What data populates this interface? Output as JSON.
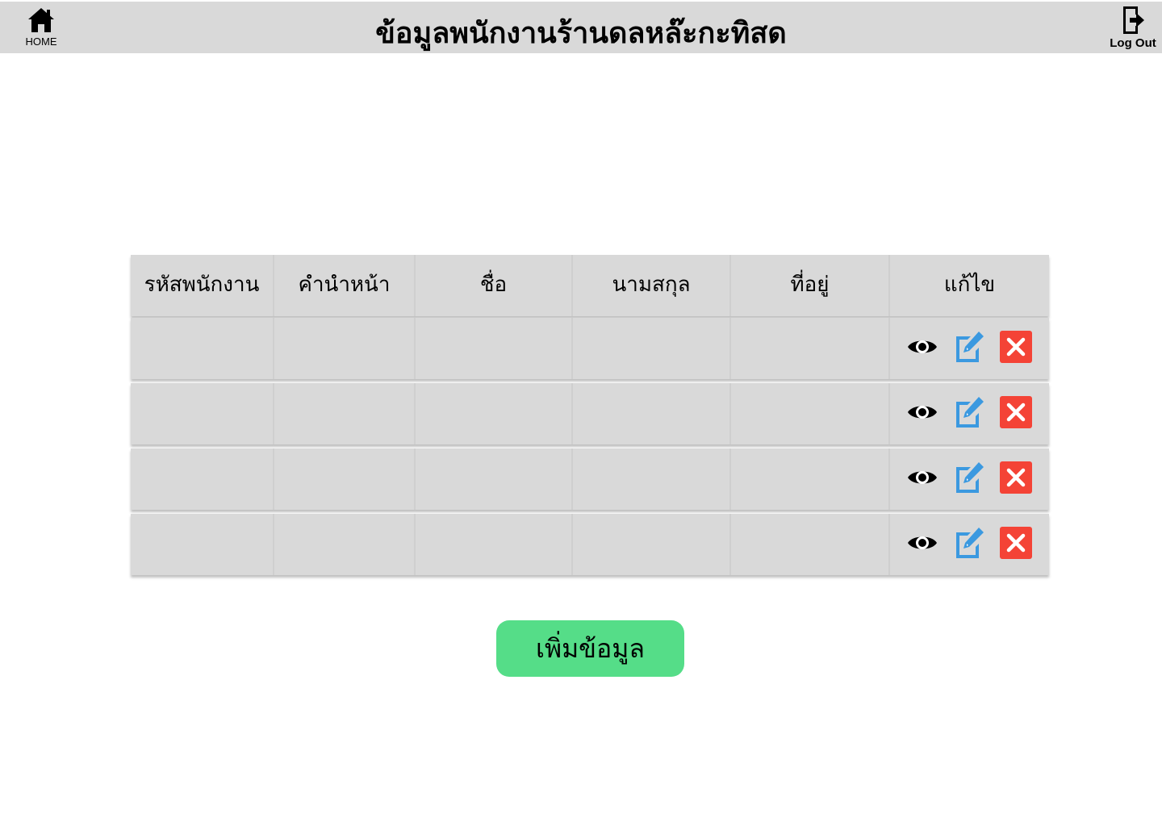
{
  "header": {
    "title": "ข้อมูลพนักงานร้านดลหล๊ะกะทิสด",
    "home_label": "HOME",
    "logout_label": "Log Out"
  },
  "table": {
    "columns": [
      "รหัสพนักงาน",
      "คำนำหน้า",
      "ชื่อ",
      "นามสกุล",
      "ที่อยู่",
      "แก้ไข"
    ],
    "rows": [
      {
        "cells": [
          "",
          "",
          "",
          "",
          ""
        ]
      },
      {
        "cells": [
          "",
          "",
          "",
          "",
          ""
        ]
      },
      {
        "cells": [
          "",
          "",
          "",
          "",
          ""
        ]
      },
      {
        "cells": [
          "",
          "",
          "",
          "",
          ""
        ]
      }
    ],
    "action_icons": [
      "eye-icon",
      "edit-icon",
      "delete-icon"
    ]
  },
  "add_button": {
    "label": "เพิ่มข้อมูล",
    "color": "#55dd88"
  },
  "colors": {
    "header_bg": "#d9d9d9",
    "edit_blue": "#3b99e0",
    "delete_red": "#f44336"
  }
}
